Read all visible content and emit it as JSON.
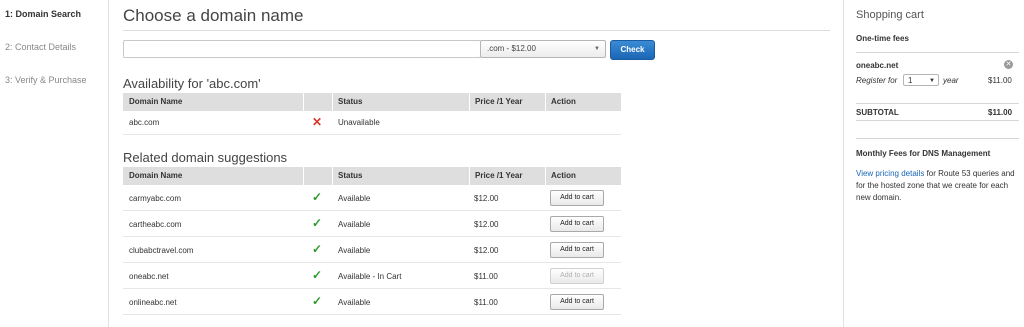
{
  "steps": [
    {
      "label": "1: Domain Search"
    },
    {
      "label": "2: Contact Details"
    },
    {
      "label": "3: Verify & Purchase"
    }
  ],
  "main": {
    "title": "Choose a domain name",
    "search": {
      "value": "",
      "placeholder": ""
    },
    "tld_select": {
      "selected": ".com - $12.00"
    },
    "check_label": "Check"
  },
  "availability": {
    "heading": "Availability for 'abc.com'",
    "columns": [
      "Domain Name",
      "Status",
      "Price /1 Year",
      "Action"
    ],
    "rows": [
      {
        "domain": "abc.com",
        "status": "Unavailable",
        "available": false,
        "price": "",
        "action": ""
      }
    ]
  },
  "suggestions": {
    "heading": "Related domain suggestions",
    "columns": [
      "Domain Name",
      "Status",
      "Price /1 Year",
      "Action"
    ],
    "rows": [
      {
        "domain": "carmyabc.com",
        "status": "Available",
        "available": true,
        "price": "$12.00",
        "action": "Add to cart",
        "disabled": false
      },
      {
        "domain": "cartheabc.com",
        "status": "Available",
        "available": true,
        "price": "$12.00",
        "action": "Add to cart",
        "disabled": false
      },
      {
        "domain": "clubabctravel.com",
        "status": "Available",
        "available": true,
        "price": "$12.00",
        "action": "Add to cart",
        "disabled": false
      },
      {
        "domain": "oneabc.net",
        "status": "Available - In Cart",
        "available": true,
        "price": "$11.00",
        "action": "Add to cart",
        "disabled": true
      },
      {
        "domain": "onlineabc.net",
        "status": "Available",
        "available": true,
        "price": "$11.00",
        "action": "Add to cart",
        "disabled": false
      }
    ]
  },
  "cart": {
    "title": "Shopping cart",
    "onetime_label": "One-time fees",
    "item_name": "oneabc.net",
    "register_for": "Register for",
    "years": "1",
    "year_label": "year",
    "item_price": "$11.00",
    "subtotal_label": "SUBTOTAL",
    "subtotal_value": "$11.00",
    "monthly_label": "Monthly Fees for DNS Management",
    "pricing_link": "View pricing details",
    "pricing_text": " for Route 53 queries and for the hosted zone that we create for each new domain."
  },
  "icons": {
    "check": "checkmark-icon",
    "cross": "cross-icon",
    "remove": "remove-icon",
    "caret": "caret-down-icon"
  },
  "colors": {
    "accent": "#1a66b5",
    "ok": "#2e9a2e",
    "error": "#d43a2a",
    "header_bg": "#dedede"
  }
}
